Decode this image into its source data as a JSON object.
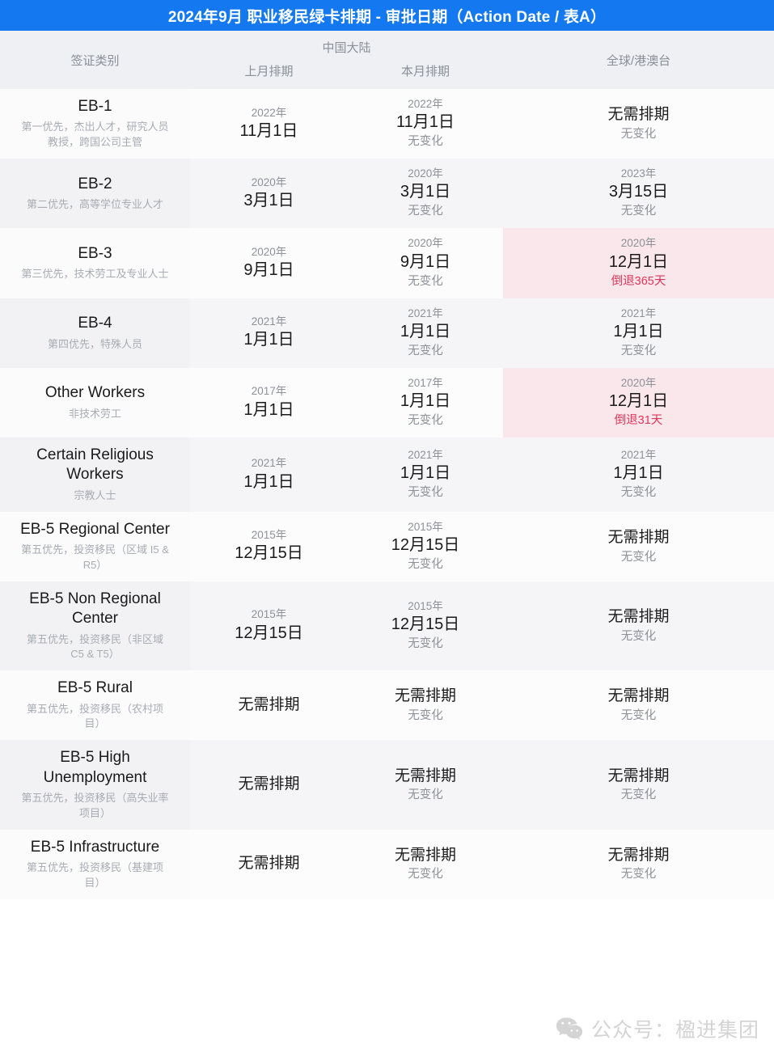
{
  "header": {
    "title": "2024年9月 职业移民绿卡排期 - 审批日期（Action Date / 表A）",
    "accent_color": "#1479f0"
  },
  "columns": {
    "category": "签证类别",
    "china_group": "中国大陆",
    "prev_month": "上月排期",
    "current_month": "本月排期",
    "global": "全球/港澳台"
  },
  "labels": {
    "no_backlog": "无需排期",
    "no_change": "无变化",
    "highlight_color": "#f9e7eb",
    "retro_color": "#e0365a"
  },
  "table_data": {
    "type": "table",
    "columns": [
      "签证类别",
      "上月排期",
      "本月排期",
      "全球/港澳台"
    ],
    "rows": [
      {
        "category": "EB-1",
        "category_sub": "第一优先，杰出人才，研究人员\n教授，跨国公司主管",
        "prev": {
          "year": "2022年",
          "date": "11月1日",
          "note": ""
        },
        "current": {
          "year": "2022年",
          "date": "11月1日",
          "note": "无变化"
        },
        "global": {
          "year": "",
          "date": "无需排期",
          "note": "无变化",
          "highlight": false
        }
      },
      {
        "category": "EB-2",
        "category_sub": "第二优先，高等学位专业人才",
        "prev": {
          "year": "2020年",
          "date": "3月1日",
          "note": ""
        },
        "current": {
          "year": "2020年",
          "date": "3月1日",
          "note": "无变化"
        },
        "global": {
          "year": "2023年",
          "date": "3月15日",
          "note": "无变化",
          "highlight": false
        }
      },
      {
        "category": "EB-3",
        "category_sub": "第三优先，技术劳工及专业人士",
        "prev": {
          "year": "2020年",
          "date": "9月1日",
          "note": ""
        },
        "current": {
          "year": "2020年",
          "date": "9月1日",
          "note": "无变化"
        },
        "global": {
          "year": "2020年",
          "date": "12月1日",
          "note": "倒退365天",
          "highlight": true
        }
      },
      {
        "category": "EB-4",
        "category_sub": "第四优先，特殊人员",
        "prev": {
          "year": "2021年",
          "date": "1月1日",
          "note": ""
        },
        "current": {
          "year": "2021年",
          "date": "1月1日",
          "note": "无变化"
        },
        "global": {
          "year": "2021年",
          "date": "1月1日",
          "note": "无变化",
          "highlight": false
        }
      },
      {
        "category": "Other Workers",
        "category_sub": "非技术劳工",
        "prev": {
          "year": "2017年",
          "date": "1月1日",
          "note": ""
        },
        "current": {
          "year": "2017年",
          "date": "1月1日",
          "note": "无变化"
        },
        "global": {
          "year": "2020年",
          "date": "12月1日",
          "note": "倒退31天",
          "highlight": true
        }
      },
      {
        "category": "Certain Religious\nWorkers",
        "category_sub": "宗教人士",
        "prev": {
          "year": "2021年",
          "date": "1月1日",
          "note": ""
        },
        "current": {
          "year": "2021年",
          "date": "1月1日",
          "note": "无变化"
        },
        "global": {
          "year": "2021年",
          "date": "1月1日",
          "note": "无变化",
          "highlight": false
        }
      },
      {
        "category": "EB-5 Regional Center",
        "category_sub": "第五优先，投资移民（区域 I5 &\nR5）",
        "prev": {
          "year": "2015年",
          "date": "12月15日",
          "note": ""
        },
        "current": {
          "year": "2015年",
          "date": "12月15日",
          "note": "无变化"
        },
        "global": {
          "year": "",
          "date": "无需排期",
          "note": "无变化",
          "highlight": false
        }
      },
      {
        "category": "EB-5 Non Regional\nCenter",
        "category_sub": "第五优先，投资移民（非区域\nC5 & T5）",
        "prev": {
          "year": "2015年",
          "date": "12月15日",
          "note": ""
        },
        "current": {
          "year": "2015年",
          "date": "12月15日",
          "note": "无变化"
        },
        "global": {
          "year": "",
          "date": "无需排期",
          "note": "无变化",
          "highlight": false
        }
      },
      {
        "category": "EB-5 Rural",
        "category_sub": "第五优先，投资移民（农村项\n目）",
        "prev": {
          "year": "",
          "date": "无需排期",
          "note": ""
        },
        "current": {
          "year": "",
          "date": "无需排期",
          "note": "无变化"
        },
        "global": {
          "year": "",
          "date": "无需排期",
          "note": "无变化",
          "highlight": false
        }
      },
      {
        "category": "EB-5 High\nUnemployment",
        "category_sub": "第五优先，投资移民（高失业率\n项目）",
        "prev": {
          "year": "",
          "date": "无需排期",
          "note": ""
        },
        "current": {
          "year": "",
          "date": "无需排期",
          "note": "无变化"
        },
        "global": {
          "year": "",
          "date": "无需排期",
          "note": "无变化",
          "highlight": false
        }
      },
      {
        "category": "EB-5 Infrastructure",
        "category_sub": "第五优先，投资移民（基建项\n目）",
        "prev": {
          "year": "",
          "date": "无需排期",
          "note": ""
        },
        "current": {
          "year": "",
          "date": "无需排期",
          "note": "无变化"
        },
        "global": {
          "year": "",
          "date": "无需排期",
          "note": "无变化",
          "highlight": false
        }
      }
    ]
  },
  "watermark": {
    "icon": "wechat-icon",
    "text": "公众号：楹进集团"
  }
}
